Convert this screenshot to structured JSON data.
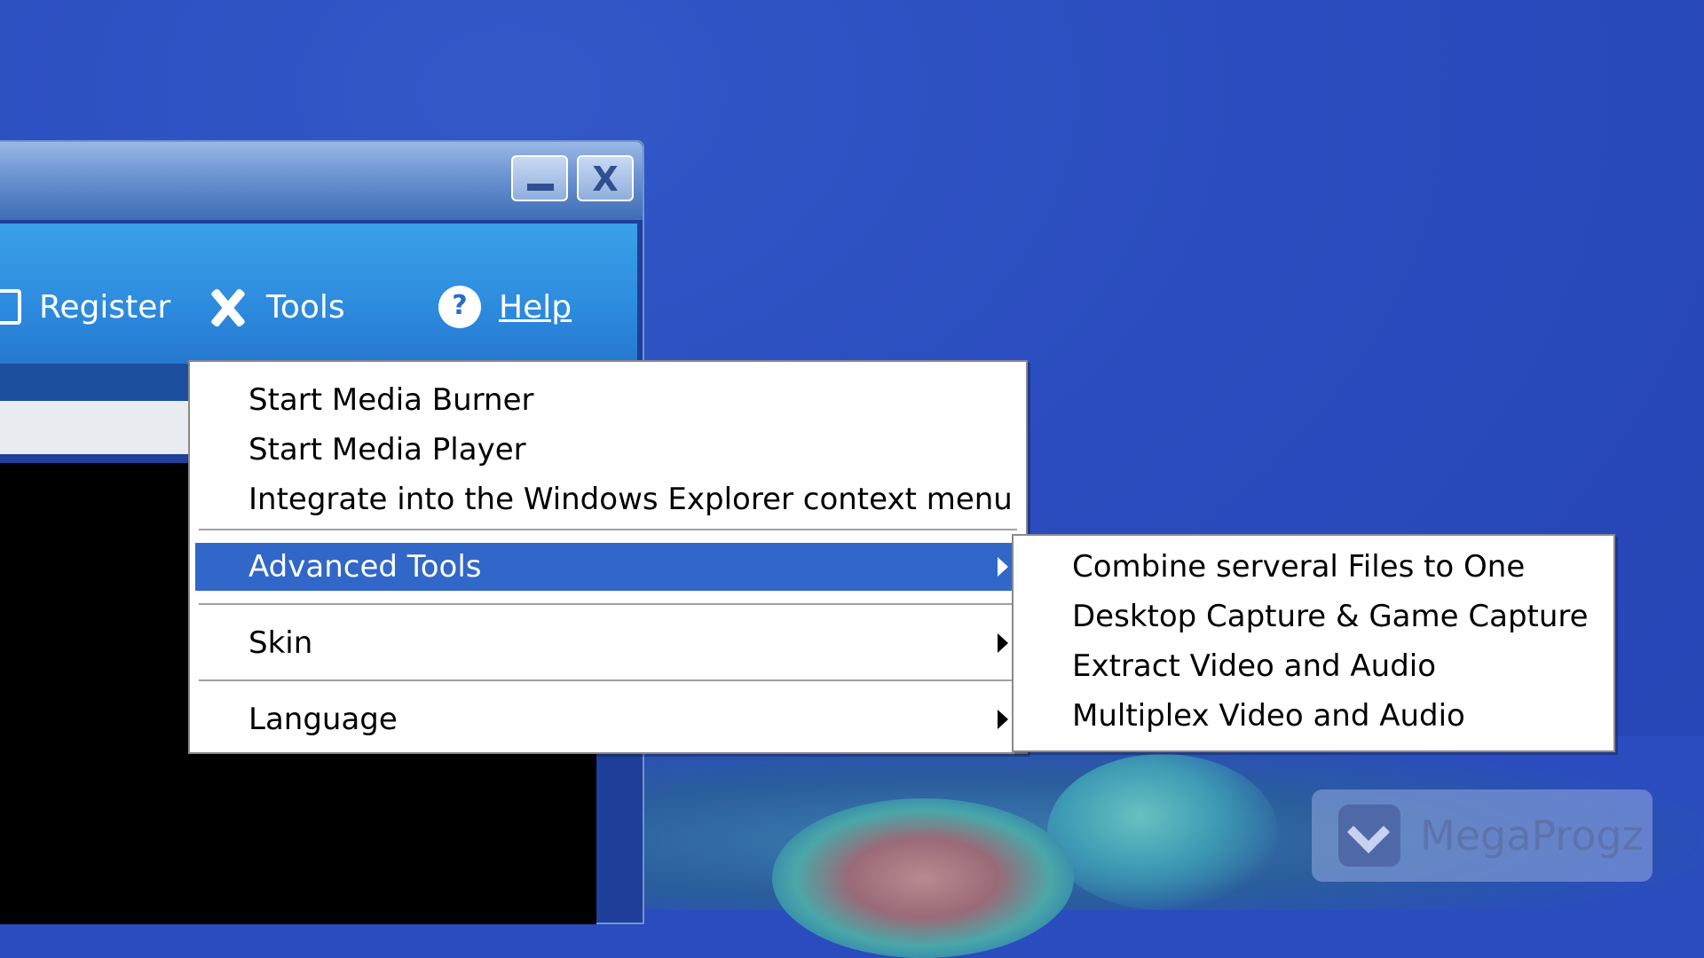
{
  "toolbar": {
    "register_label": "Register",
    "tools_label": "Tools",
    "help_label": "Help",
    "help_icon_glyph": "?"
  },
  "window_buttons": {
    "close_glyph": "X"
  },
  "menu": {
    "items": [
      {
        "label": "Start Media Burner"
      },
      {
        "label": "Start Media Player"
      },
      {
        "label": "Integrate into the Windows Explorer context menu"
      },
      {
        "label": "Advanced Tools",
        "submenu": true,
        "selected": true
      },
      {
        "label": "Skin",
        "submenu": true
      },
      {
        "label": "Language",
        "submenu": true
      }
    ]
  },
  "submenu": {
    "items": [
      {
        "label": "Combine serveral Files to One"
      },
      {
        "label": "Desktop Capture & Game Capture"
      },
      {
        "label": "Extract Video and Audio"
      },
      {
        "label": "Multiplex Video and Audio"
      }
    ]
  },
  "watermark": {
    "text": "MegaProgz"
  },
  "colors": {
    "menu_highlight": "#3167c8",
    "desktop": "#2a4cbe",
    "toolbar": "#2d8bde"
  }
}
